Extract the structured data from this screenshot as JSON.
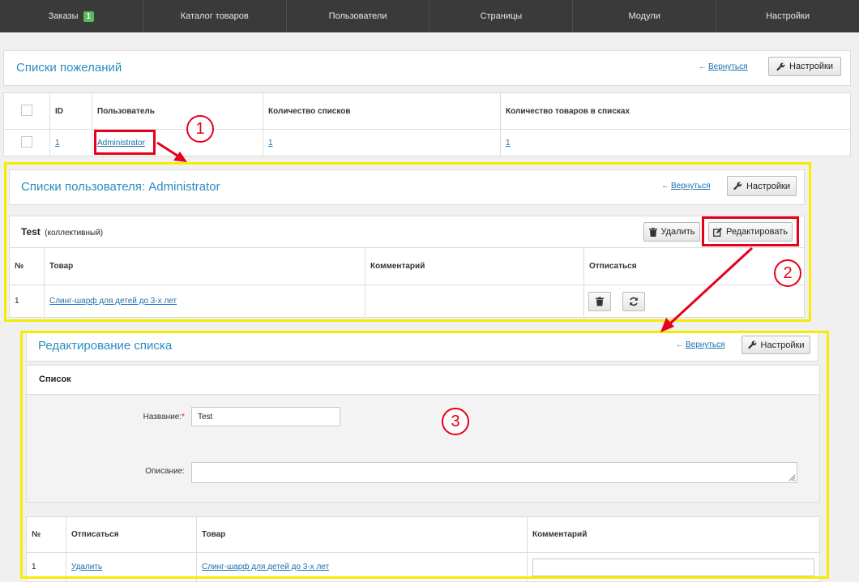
{
  "nav": {
    "orders": "Заказы",
    "orders_badge": "1",
    "catalog": "Каталог товаров",
    "users": "Пользователи",
    "pages": "Страницы",
    "modules": "Модули",
    "settings": "Настройки"
  },
  "wishlists": {
    "title": "Списки пожеланий",
    "back": "Вернуться",
    "settings_btn": "Настройки",
    "columns": [
      "ID",
      "Пользователь",
      "Количество списков",
      "Количество товаров в списках"
    ],
    "row": {
      "id": "1",
      "user": "Administrator",
      "lists_count": "1",
      "items_count": "1"
    }
  },
  "user_lists": {
    "title": "Списки пользователя: Administrator",
    "back": "Вернуться",
    "settings_btn": "Настройки",
    "list_name": "Test",
    "list_type": "(коллективный)",
    "delete_btn": "Удалить",
    "edit_btn": "Редактировать",
    "columns": [
      "№",
      "Товар",
      "Комментарий",
      "Отписаться"
    ],
    "row": {
      "num": "1",
      "product": "Слинг-шарф для детей до 3-х лет",
      "comment": ""
    }
  },
  "edit_list": {
    "title": "Редактирование списка",
    "back": "Вернуться",
    "settings_btn": "Настройки",
    "section_title": "Список",
    "name_label": "Название:",
    "required_mark": "*",
    "name_value": "Test",
    "desc_label": "Описание:",
    "desc_value": "",
    "columns": [
      "№",
      "Отписаться",
      "Товар",
      "Комментарий"
    ],
    "row": {
      "num": "1",
      "unsubscribe": "Удалить",
      "product": "Слинг-шарф для детей до 3-х лет",
      "comment": ""
    }
  },
  "annotations": {
    "step1": "1",
    "step2": "2",
    "step3": "3"
  },
  "colors": {
    "nav_bg": "#3a3a3a",
    "accent": "#2b8cbf",
    "link": "#1a6fb0",
    "highlight_yellow": "#f5ec00",
    "highlight_red": "#e5001b",
    "badge": "#5cb85c"
  }
}
